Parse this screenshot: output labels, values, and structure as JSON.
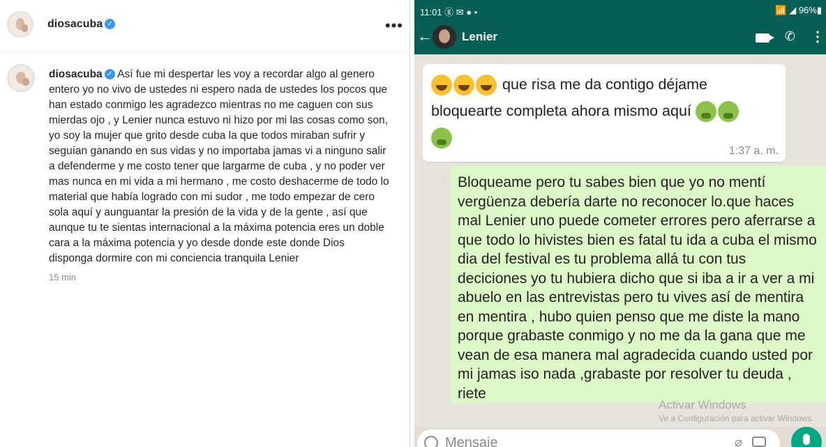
{
  "instagram": {
    "username": "diosacuba",
    "more_label": "•••",
    "caption": "Así fue mi despertar les voy a recordar algo al genero entero yo no vivo de ustedes ni espero nada de ustedes los pocos que han estado conmigo les agradezco mientras no me caguen con sus mierdas ojo , y Lenier nunca estuvo ni hizo por mi las cosas como son, yo soy la mujer que grito desde cuba la que todos miraban sufrir y seguían ganando en sus vidas y no importaba jamas vi a ninguno salir a defenderme y me costo tener que largarme de cuba , y no poder ver mas nunca en mi vida a mi hermano , me costo deshacerme de todo lo material que había logrado con mi sudor , me todo empezar de cero sola aquí y aunguantar la presión de la vida y de la gente , así que aunque tu te sientas internacional a la máxima potencia eres un doble cara a la máxima potencia y yo desde donde este donde Dios disponga dormire con mi conciencia tranquila Lenier",
    "time": "15 min",
    "verified_color": "#3897f0"
  },
  "whatsapp": {
    "status_left": "11:01 ⓖ ✉ ● •",
    "status_right": "📶 ◢ 96%▮",
    "contact_name": "Lenier",
    "back_icon": "←",
    "incoming": {
      "text_part1": "que risa me da contigo déjame",
      "text_part2": "bloquearte completa ahora mismo aquí",
      "time": "1:37 a. m."
    },
    "outgoing": {
      "text": "Bloqueame pero tu sabes bien que yo no mentí vergüenza debería darte no reconocer lo.que haces mal Lenier uno puede cometer errores pero aferrarse a que todo lo hivistes bien es fatal tu ida a cuba el mismo dia del festival es tu problema allá tu con tus deciciones yo tu hubiera dicho que si iba a ir a ver a mi abuelo en las entrevistas pero tu vives así de mentira en mentira , hubo quien penso que me diste la mano porque grabaste conmigo y no me da la gana que me vean de esa manera mal agradecida  cuando usted por mi jamas iso nada ,grabaste por resolver tu deuda , riete"
    },
    "input_placeholder": "Mensaje",
    "watermark_line1": "Activar Windows",
    "watermark_line2": "Ve a Configuración para activar Windows.",
    "colors": {
      "header": "#075e54",
      "outgoing_bubble": "#dcf8c6",
      "mic_button": "#00a884"
    }
  }
}
